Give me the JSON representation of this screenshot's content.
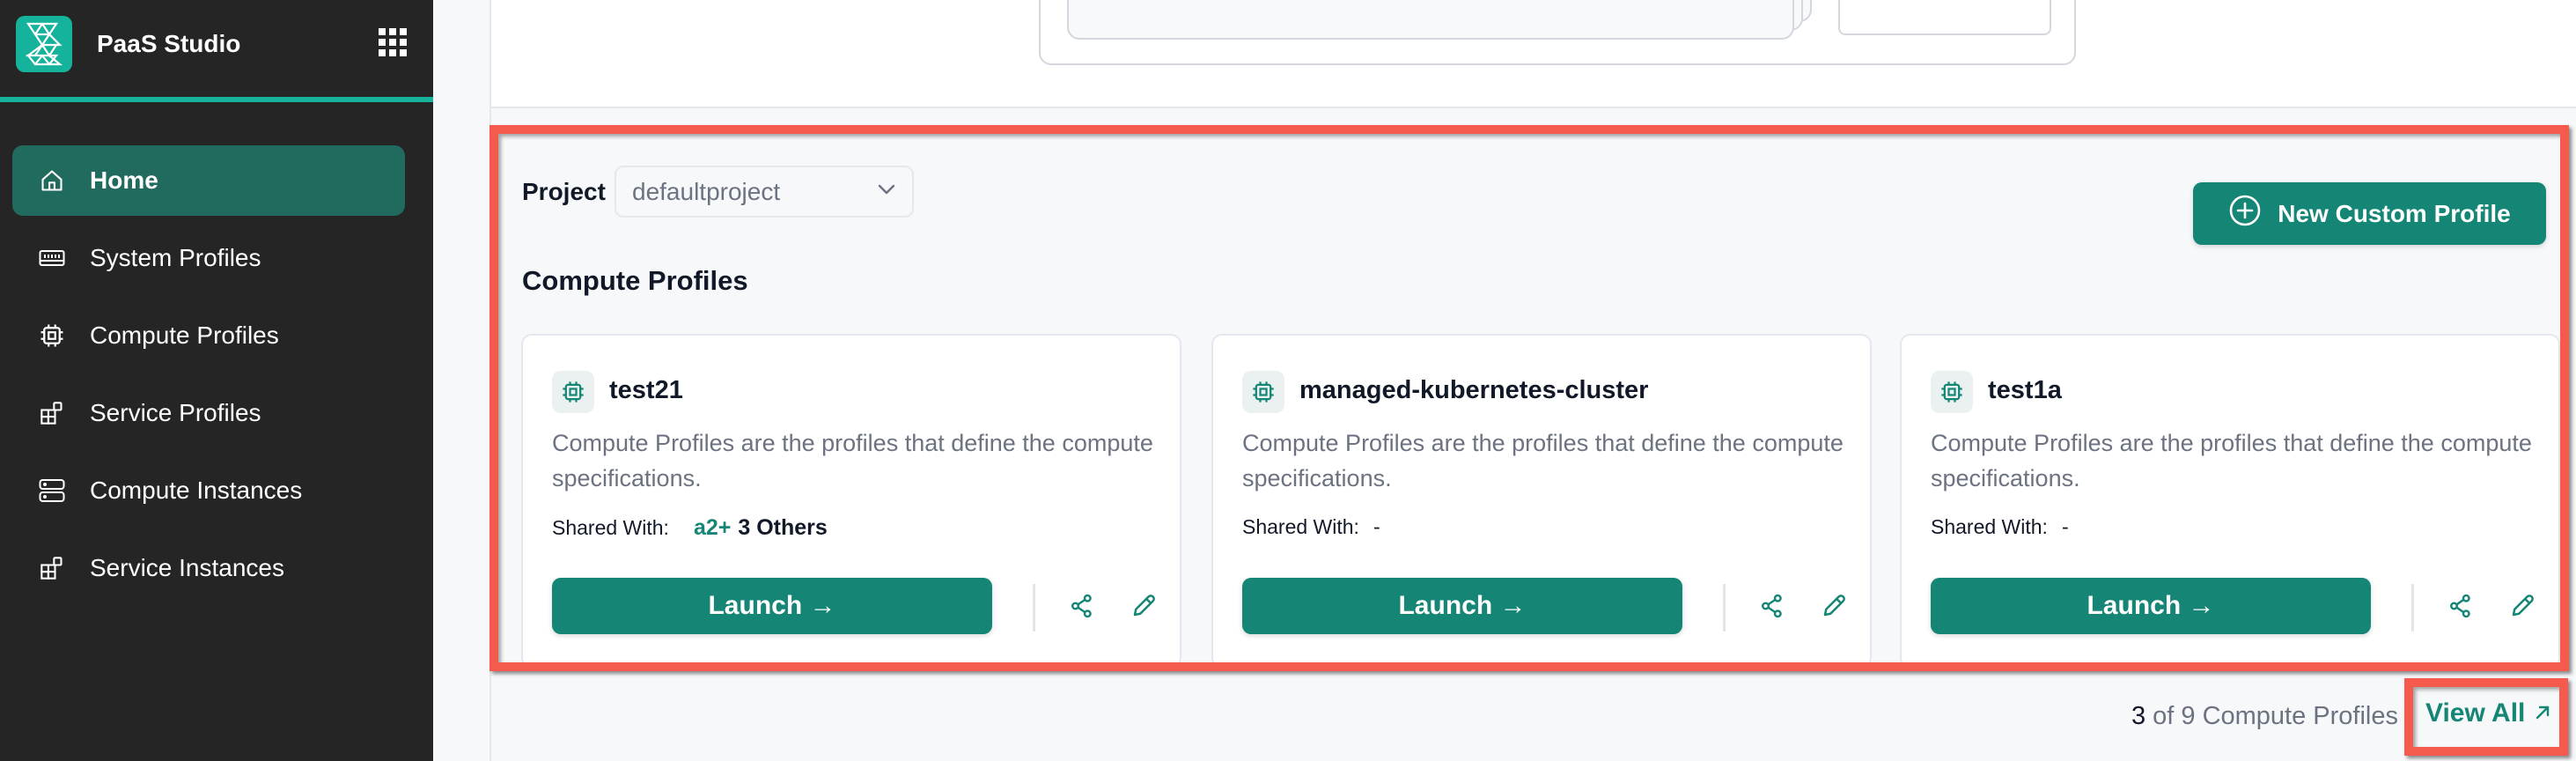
{
  "app": {
    "name": "PaaS Studio"
  },
  "sidebar": {
    "items": [
      {
        "label": "Home",
        "icon": "home-icon",
        "active": true
      },
      {
        "label": "System Profiles",
        "icon": "memory-icon",
        "active": false
      },
      {
        "label": "Compute Profiles",
        "icon": "cpu-icon",
        "active": false
      },
      {
        "label": "Service Profiles",
        "icon": "blocks-icon",
        "active": false
      },
      {
        "label": "Compute Instances",
        "icon": "server-icon",
        "active": false
      },
      {
        "label": "Service Instances",
        "icon": "blocks-icon",
        "active": false
      }
    ]
  },
  "project": {
    "label": "Project",
    "selected": "defaultproject"
  },
  "toolbar": {
    "new_profile_label": "New Custom Profile"
  },
  "section": {
    "title": "Compute Profiles"
  },
  "cards": [
    {
      "title": "test21",
      "description": "Compute Profiles are the profiles that define the compute specifications.",
      "shared_label": "Shared With:",
      "shared_highlight": "a2+",
      "shared_others": "3 Others",
      "shared_value": "",
      "launch_label": "Launch →"
    },
    {
      "title": "managed-kubernetes-cluster",
      "description": "Compute Profiles are the profiles that define the compute specifications.",
      "shared_label": "Shared With:",
      "shared_highlight": "",
      "shared_others": "",
      "shared_value": "-",
      "launch_label": "Launch →"
    },
    {
      "title": "test1a",
      "description": "Compute Profiles are the profiles that define the compute specifications.",
      "shared_label": "Shared With:",
      "shared_highlight": "",
      "shared_others": "",
      "shared_value": "-",
      "launch_label": "Launch →"
    }
  ],
  "footer": {
    "shown": "3",
    "rest": " of 9 Compute Profiles",
    "view_all_label": "View All",
    "view_all_icon": "↗"
  },
  "colors": {
    "brand": "#16b39c",
    "primary": "#158675",
    "active_nav": "#216a5e",
    "sidebar_bg": "#252525",
    "annotation": "#f55a4c"
  }
}
